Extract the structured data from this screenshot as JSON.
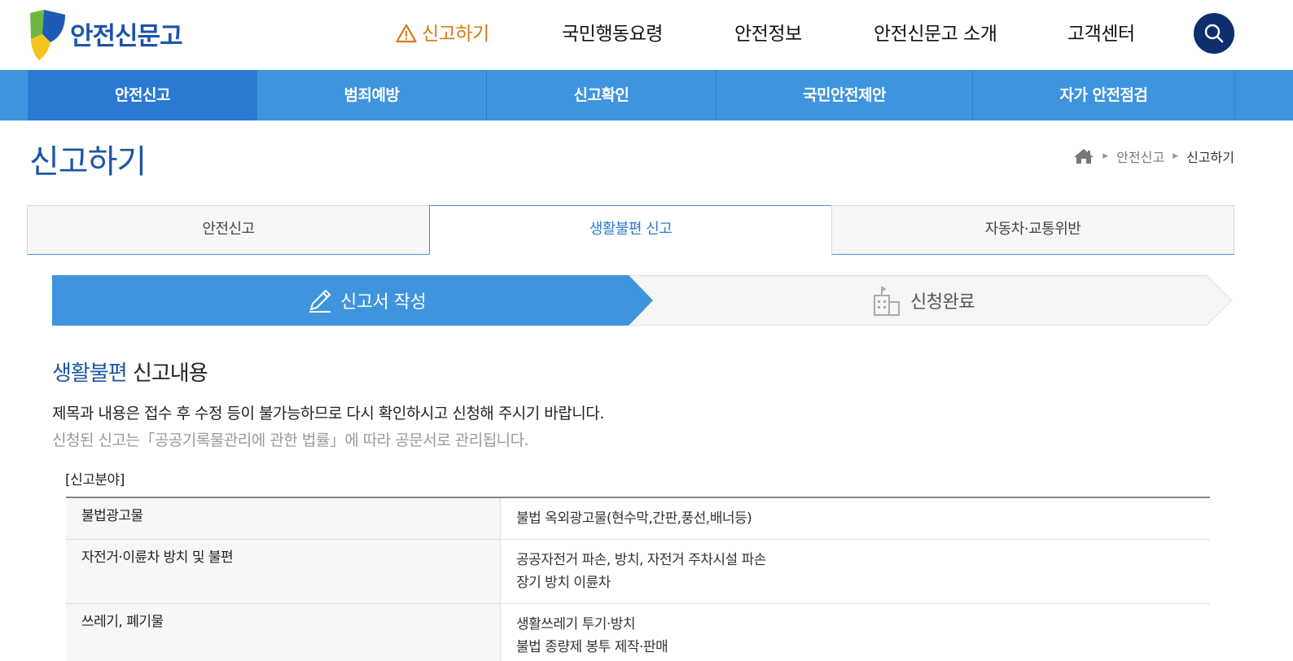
{
  "header": {
    "logo_text": "안전신문고",
    "gnb": [
      {
        "label": "신고하기",
        "active": true
      },
      {
        "label": "국민행동요령",
        "active": false
      },
      {
        "label": "안전정보",
        "active": false
      },
      {
        "label": "안전신문고 소개",
        "active": false
      },
      {
        "label": "고객센터",
        "active": false
      }
    ],
    "search_icon": "search-icon"
  },
  "subnav": [
    {
      "label": "안전신고",
      "active": true
    },
    {
      "label": "범죄예방",
      "active": false
    },
    {
      "label": "신고확인",
      "active": false
    },
    {
      "label": "국민안전제안",
      "active": false
    },
    {
      "label": "자가 안전점검",
      "active": false
    }
  ],
  "page": {
    "title": "신고하기",
    "breadcrumb": [
      "안전신고",
      "신고하기"
    ]
  },
  "tabs": [
    {
      "label": "안전신고",
      "active": false
    },
    {
      "label": "생활불편 신고",
      "active": true
    },
    {
      "label": "자동차·교통위반",
      "active": false
    }
  ],
  "steps": [
    {
      "label": "신고서 작성",
      "icon": "pencil-icon",
      "active": true
    },
    {
      "label": "신청완료",
      "icon": "building-icon",
      "active": false
    }
  ],
  "section": {
    "title_highlight": "생활불편",
    "title_rest": " 신고내용",
    "notice_primary": "제목과 내용은 접수 후 수정 등이 불가능하므로 다시 확인하시고 신청해 주시기 바랍니다.",
    "notice_secondary": "신청된 신고는「공공기록물관리에 관한 법률」에 따라 공문서로 관리됩니다.",
    "field_label": "[신고분야]"
  },
  "categories": [
    {
      "name": "불법광고물",
      "desc": [
        "불법 옥외광고물(현수막,간판,풍선,배너등)"
      ]
    },
    {
      "name": "자전거·이륜차 방치 및 불편",
      "desc": [
        "공공자전거 파손, 방치, 자전거 주차시설 파손",
        "장기 방치 이륜차"
      ]
    },
    {
      "name": "쓰레기, 폐기물",
      "desc": [
        "생활쓰레기 투기·방치",
        "불법 종량제 봉투 제작·판매"
      ]
    }
  ],
  "colors": {
    "brand_navy": "#1b55a8",
    "nav_blue": "#3f94de",
    "active_orange": "#d9781a"
  }
}
